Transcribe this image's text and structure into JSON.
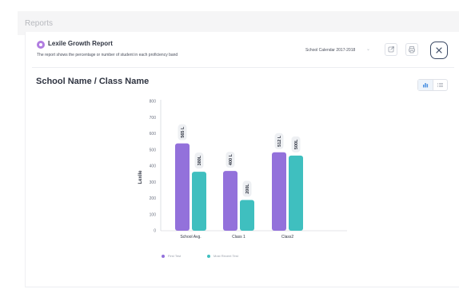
{
  "header": {
    "section_title": "Reports"
  },
  "report": {
    "name": "Lexile Growth Report",
    "description": "The report shows the percentage or number of student in each proficiency band",
    "calendar": "School Calendar 2017-2018",
    "calendar_caret_icon": "chevron-down-icon",
    "export_icon": "export-icon",
    "print_icon": "print-icon",
    "close_icon": "close-icon"
  },
  "view": {
    "title": "School Name / Class Name",
    "chart_view_icon": "bar-chart-icon",
    "list_view_icon": "list-icon"
  },
  "colors": {
    "first_test": "#9371db",
    "most_recent_test": "#3fbfbf",
    "accent": "#b07ce0",
    "close_border": "#3d4b66"
  },
  "chart_data": {
    "type": "bar",
    "title": "",
    "xlabel": "",
    "ylabel": "Lexile",
    "ylim": [
      0,
      800
    ],
    "yticks": [
      "0",
      "100",
      "200",
      "300",
      "400",
      "500",
      "600",
      "700",
      "800"
    ],
    "categories": [
      "School Avg.",
      "Class 1",
      "Class2"
    ],
    "series": [
      {
        "name": "First Test",
        "values": [
          540,
          370,
          485
        ],
        "labels": [
          "565 L",
          "400 L",
          "512 L"
        ]
      },
      {
        "name": "Most Recent Test",
        "values": [
          365,
          190,
          465
        ],
        "labels": [
          "380L",
          "200L",
          "500L"
        ]
      }
    ],
    "legend": "bottom",
    "grid": false
  }
}
